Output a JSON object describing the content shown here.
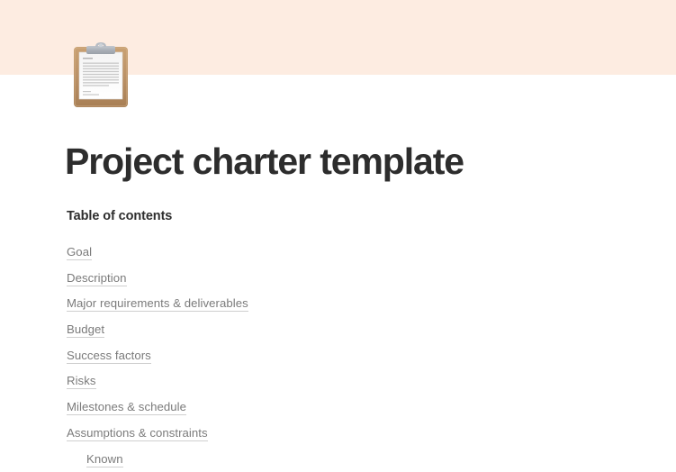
{
  "theme": {
    "band_color": "#fdece1",
    "page_background": "#ffffff",
    "title_color": "#2d2d2d",
    "link_color": "#7b7b7b",
    "link_underline_color": "#cfcfcf"
  },
  "header": {
    "icon": "clipboard-icon",
    "icon_glyph": "📋"
  },
  "title": "Project charter template",
  "toc": {
    "heading": "Table of contents",
    "items": [
      {
        "label": "Goal",
        "level": 1
      },
      {
        "label": "Description",
        "level": 1
      },
      {
        "label": "Major requirements & deliverables",
        "level": 1
      },
      {
        "label": "Budget",
        "level": 1
      },
      {
        "label": "Success factors",
        "level": 1
      },
      {
        "label": "Risks",
        "level": 1
      },
      {
        "label": "Milestones & schedule",
        "level": 1
      },
      {
        "label": "Assumptions & constraints",
        "level": 1
      },
      {
        "label": "Known",
        "level": 2
      }
    ]
  }
}
